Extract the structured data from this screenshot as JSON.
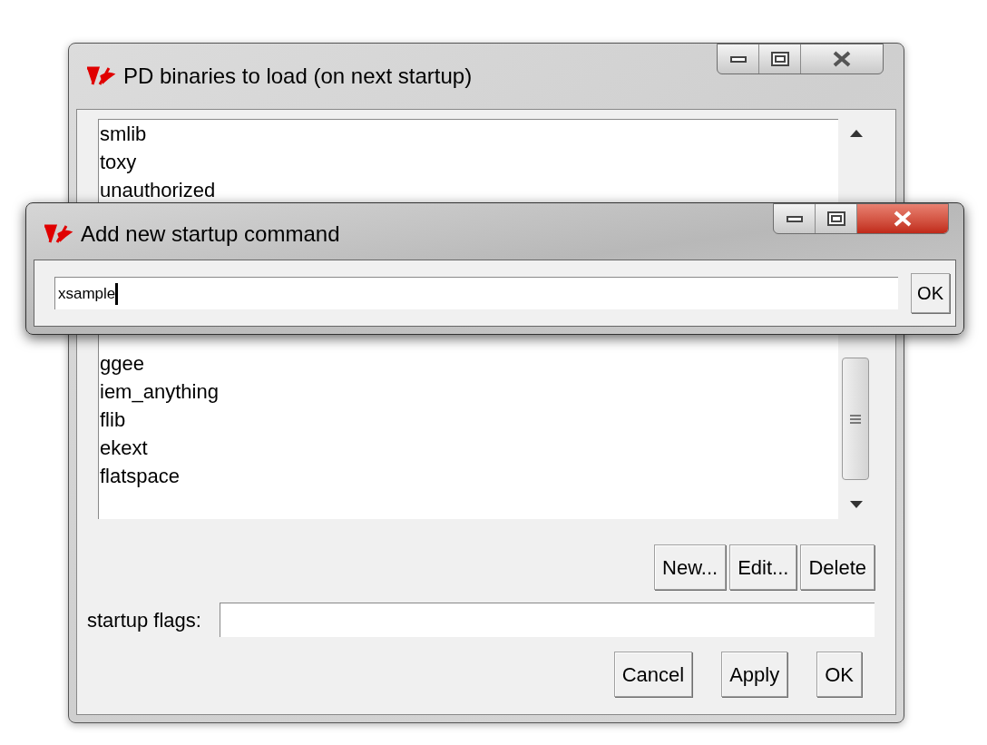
{
  "main_window": {
    "title": "PD binaries to load (on next startup)",
    "listbox": {
      "items_top": [
        "smlib",
        "toxy",
        "unauthorized"
      ],
      "items_bottom": [
        "ggee",
        "iem_anything",
        "flib",
        "ekext",
        "flatspace"
      ]
    },
    "list_buttons": [
      "New...",
      "Edit...",
      "Delete"
    ],
    "startup_flags": {
      "label": "startup flags:"
    },
    "buttons": [
      "Cancel",
      "Apply",
      "OK"
    ]
  },
  "dialog": {
    "title": "Add new startup command",
    "value": "xsample",
    "ok_button": "OK"
  }
}
